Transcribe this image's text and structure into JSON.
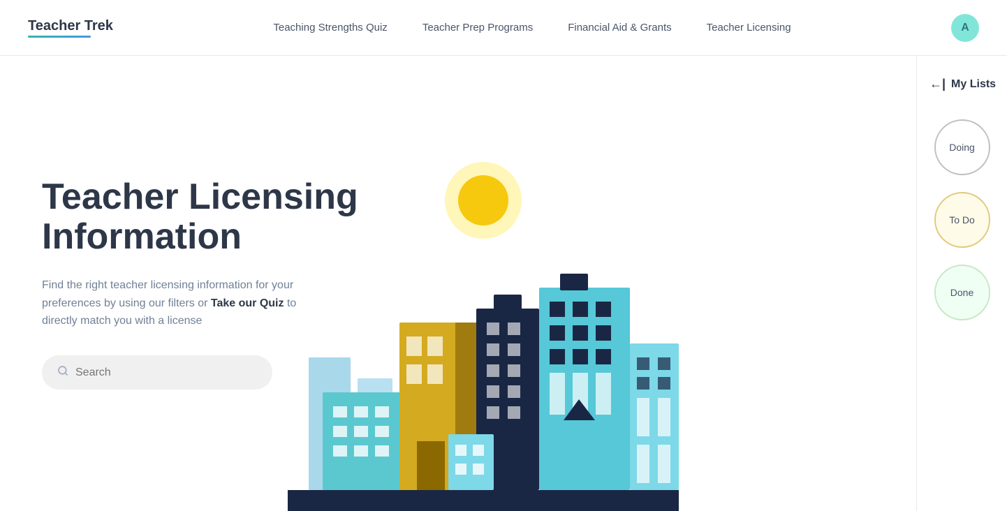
{
  "nav": {
    "logo": "Teacher Trek",
    "links": [
      {
        "label": "Teaching Strengths Quiz",
        "id": "quiz"
      },
      {
        "label": "Teacher Prep Programs",
        "id": "prep"
      },
      {
        "label": "Financial Aid & Grants",
        "id": "financial"
      },
      {
        "label": "Teacher Licensing",
        "id": "licensing"
      }
    ],
    "avatar_letter": "A"
  },
  "hero": {
    "title_line1": "Teacher Licensing",
    "title_line2": "Information",
    "subtitle_start": "Find the right teacher licensing information for your preferences by using our filters or ",
    "subtitle_link": "Take our Quiz",
    "subtitle_end": " to directly match you with a license"
  },
  "search": {
    "placeholder": "Search"
  },
  "sidebar": {
    "my_lists_label": "My Lists",
    "doing_label": "Doing",
    "todo_label": "To Do",
    "done_label": "Done"
  }
}
